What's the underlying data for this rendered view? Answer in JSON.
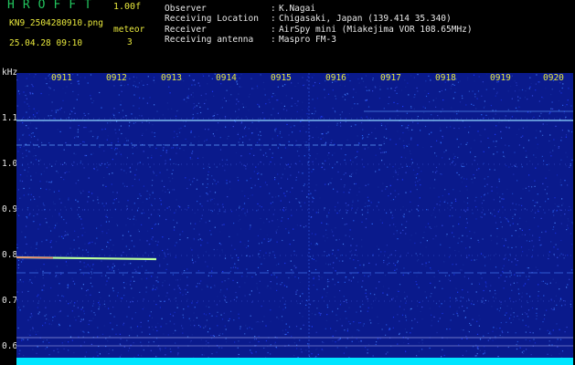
{
  "header": {
    "app_name": "HROFFT",
    "version": "1.00f",
    "filename": "KN9_2504280910.png",
    "meteor_label": "meteor",
    "datetime": "25.04.28 09:10",
    "meteor_count": "3"
  },
  "station_info": [
    {
      "label": "Observer",
      "value": "K.Nagai"
    },
    {
      "label": "Receiving Location",
      "value": "Chigasaki, Japan (139.414 35.340)"
    },
    {
      "label": "Receiver",
      "value": "AirSpy mini (Miakejima VOR 108.65MHz)"
    },
    {
      "label": "Receiving antenna",
      "value": "Maspro FM-3"
    }
  ],
  "spectrogram": {
    "unit_label": "kHz",
    "frequency_ticks": [
      "1.1",
      "1.0",
      "0.9",
      "0.8",
      "0.7",
      "0.6"
    ],
    "time_ticks": [
      "0911",
      "0912",
      "0913",
      "0914",
      "0915",
      "0916",
      "0917",
      "0918",
      "0919",
      "0920"
    ],
    "colors": {
      "background": "#0a1a8c",
      "noise": "#2f6fff",
      "signal": "#9fffd0",
      "baseline": "#00e5ff"
    }
  }
}
